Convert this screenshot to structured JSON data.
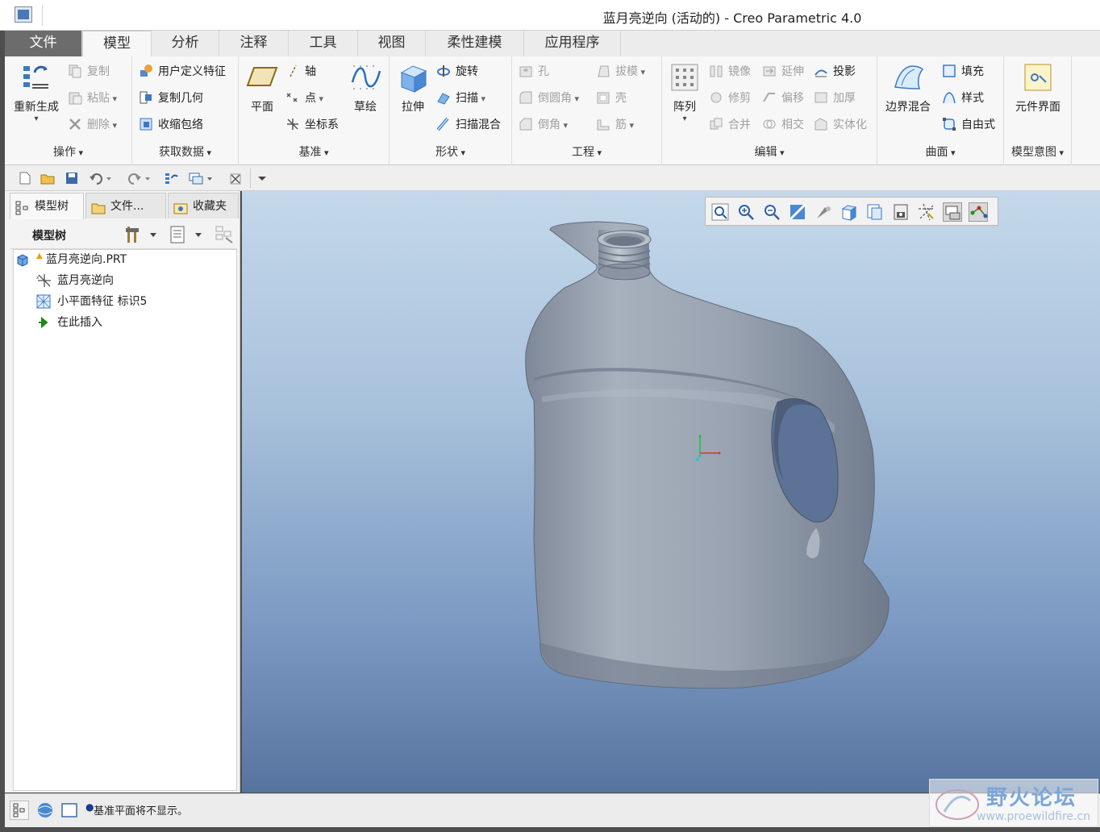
{
  "window": {
    "title": "蓝月亮逆向 (活动的) - Creo Parametric 4.0"
  },
  "tabs": [
    {
      "label": "文件"
    },
    {
      "label": "模型"
    },
    {
      "label": "分析"
    },
    {
      "label": "注释"
    },
    {
      "label": "工具"
    },
    {
      "label": "视图"
    },
    {
      "label": "柔性建模"
    },
    {
      "label": "应用程序"
    }
  ],
  "ribbon": {
    "ops": {
      "label": "操作",
      "regen": "重新生成",
      "copy": "复制",
      "paste": "粘贴",
      "delete": "删除"
    },
    "getdata": {
      "label": "获取数据",
      "udf": "用户定义特征",
      "copygeom": "复制几何",
      "shrinkwrap": "收缩包络"
    },
    "datum": {
      "label": "基准",
      "plane": "平面",
      "axis": "轴",
      "point": "点",
      "csys": "坐标系",
      "sketch": "草绘"
    },
    "shapes": {
      "label": "形状",
      "extrude": "拉伸",
      "revolve": "旋转",
      "sweep": "扫描",
      "swept_blend": "扫描混合"
    },
    "engineering": {
      "label": "工程",
      "hole": "孔",
      "draft": "拔模",
      "round": "倒圆角",
      "shell": "壳",
      "chamfer": "倒角",
      "rib": "筋"
    },
    "editing": {
      "label": "编辑",
      "pattern": "阵列",
      "mirror": "镜像",
      "extend": "延伸",
      "project": "投影",
      "trim": "修剪",
      "offset": "偏移",
      "thicken": "加厚",
      "merge": "合并",
      "intersect": "相交",
      "solidify": "实体化"
    },
    "surfaces": {
      "label": "曲面",
      "boundary_blend": "边界混合",
      "fill": "填充",
      "style": "样式",
      "freestyle": "自由式"
    },
    "intent": {
      "label": "模型意图",
      "component_interface": "元件界面"
    }
  },
  "left_panel": {
    "tabs": [
      {
        "label": "模型树"
      },
      {
        "label": "文件..."
      },
      {
        "label": "收藏夹"
      }
    ],
    "tree_header": "模型树",
    "nodes": [
      {
        "label": "蓝月亮逆向.PRT"
      },
      {
        "label": "蓝月亮逆向"
      },
      {
        "label": "小平面特征 标识5"
      },
      {
        "label": "在此插入"
      }
    ]
  },
  "status": {
    "message": "基准平面将不显示。"
  },
  "watermark": {
    "title": "野火论坛",
    "url": "www.proewildfire.cn"
  },
  "colors": {
    "file_tab": "#6c6c6c",
    "viewport_top": "#c4d8ea",
    "viewport_bottom": "#56749f",
    "model": "#98a3b3",
    "accent_blue": "#3a78c8"
  }
}
